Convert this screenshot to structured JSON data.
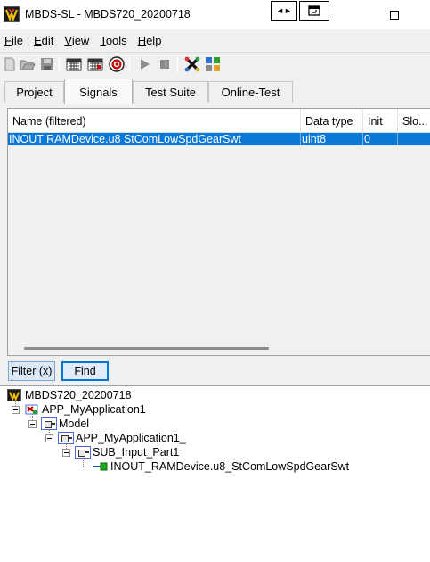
{
  "window": {
    "title": "MBDS-SL - MBDS720_20200718",
    "title_buttons": [
      "◄►",
      "❐",
      "□"
    ]
  },
  "menu": [
    {
      "key": "F",
      "rest": "ile"
    },
    {
      "key": "E",
      "rest": "dit"
    },
    {
      "key": "V",
      "rest": "iew"
    },
    {
      "key": "T",
      "rest": "ools"
    },
    {
      "key": "H",
      "rest": "elp"
    }
  ],
  "toolbar": {
    "icons": [
      "new-file-icon",
      "open-folder-icon",
      "save-icon",
      "calendar-grid-icon",
      "calendar-grid-2-icon",
      "target-icon",
      "play-icon",
      "stop-icon",
      "x-cross-icon",
      "color-grid-icon"
    ]
  },
  "tabs": [
    {
      "label": "Project",
      "active": false
    },
    {
      "label": "Signals",
      "active": true
    },
    {
      "label": "Test Suite",
      "active": false
    },
    {
      "label": "Online-Test",
      "active": false
    }
  ],
  "signals_table": {
    "columns": [
      "Name (filtered)",
      "Data type",
      "Init",
      "Slo..."
    ],
    "rows": [
      {
        "name": "INOUT RAMDevice.u8 StComLowSpdGearSwt",
        "data_type": "uint8",
        "init": "0",
        "slot": ""
      }
    ]
  },
  "buttons": {
    "filter": "Filter (x)",
    "find": "Find"
  },
  "tree": {
    "root": "MBDS720_20200718",
    "nodes": [
      {
        "label": "APP_MyApplication1",
        "icon": "application-icon"
      },
      {
        "label": "Model",
        "icon": "block-icon"
      },
      {
        "label": "APP_MyApplication1_",
        "icon": "block-icon"
      },
      {
        "label": "SUB_Input_Part1",
        "icon": "block-icon"
      },
      {
        "label": "INOUT_RAMDevice.u8_StComLowSpdGearSwt",
        "icon": "signal-arrow-icon"
      }
    ]
  },
  "colors": {
    "selection": "#0a78d7",
    "accent_button": "#0078d7",
    "background": "#f0f0f0"
  }
}
